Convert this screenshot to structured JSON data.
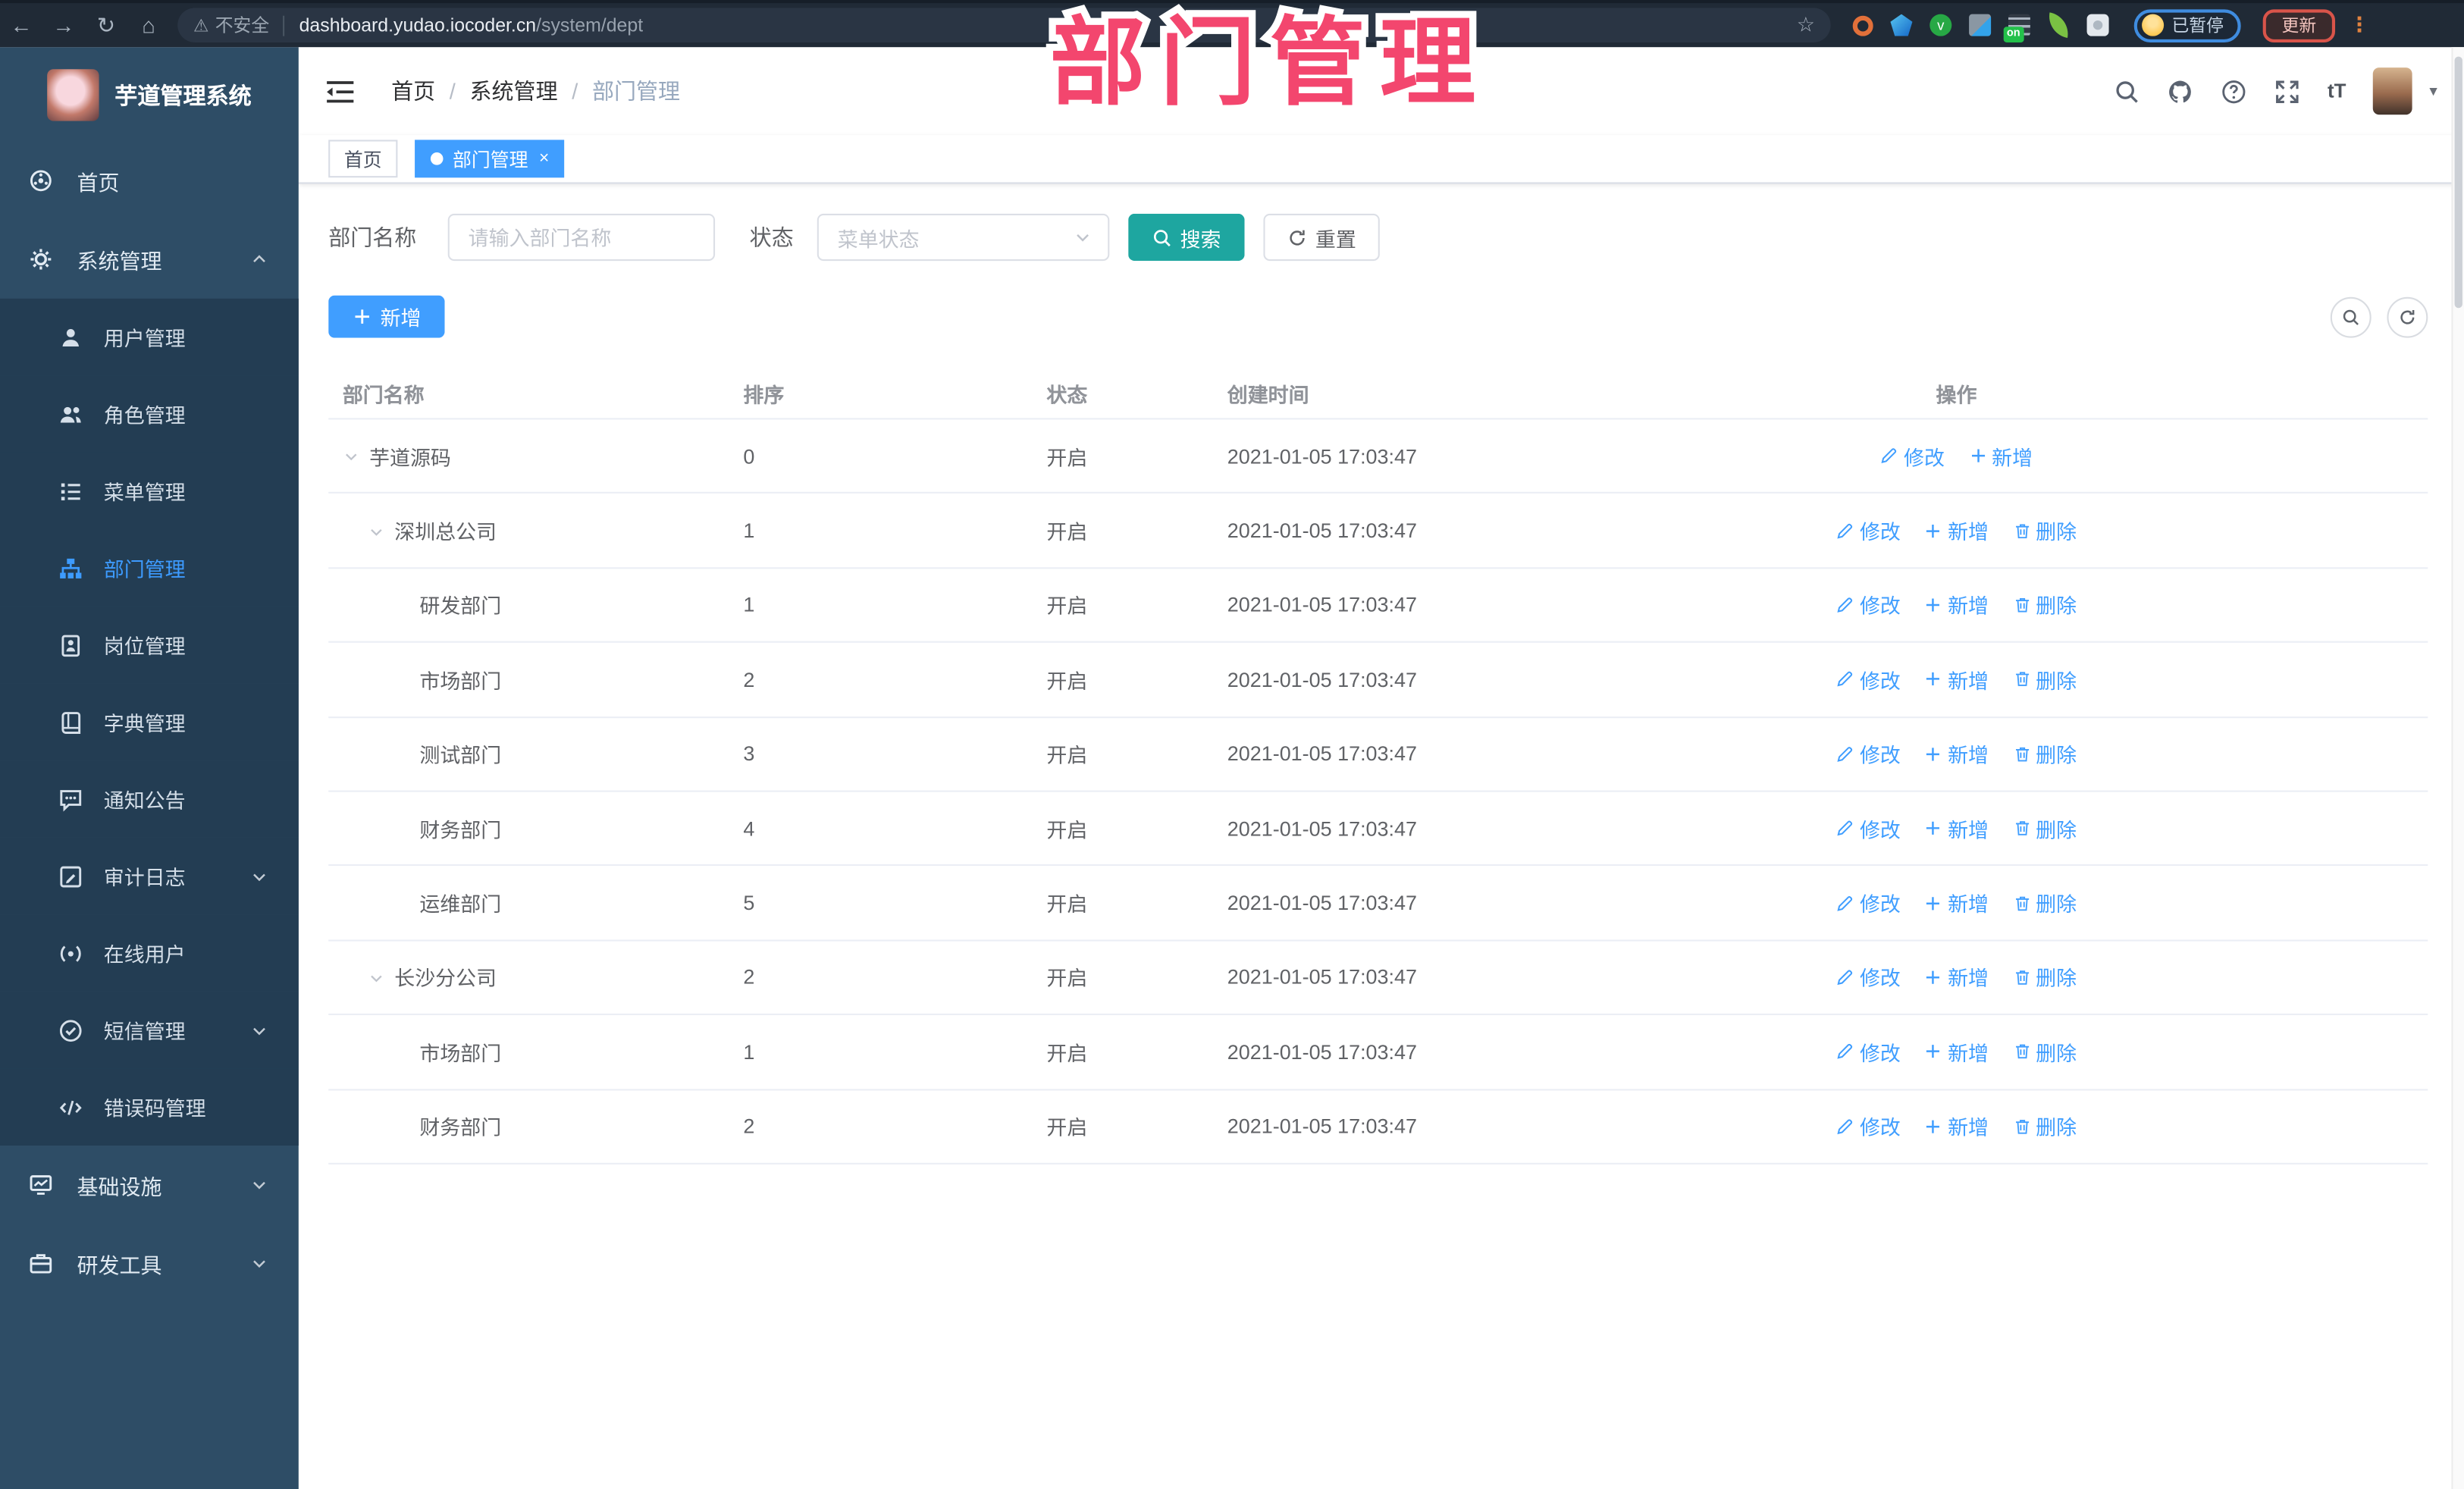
{
  "colors": {
    "accent": "#409eff",
    "search_button_teal": "#1ea6a0",
    "sidebar_bg": "#2e4d66",
    "submenu_bg": "#233d53",
    "overlay_pink": "#f3466e",
    "tab_active_blue": "#409eff"
  },
  "browser": {
    "security_label": "不安全",
    "url_host": "dashboard.yudao.iocoder.cn",
    "url_path": "/system/dept",
    "paused_label": "已暂停",
    "update_label": "更新",
    "extension_on_badge": "on",
    "extensions": [
      "orange-ring-extension-icon",
      "blue-gem-extension-icon",
      "green-check-extension-icon",
      "grey-grid-extension-icon",
      "dark-lines-extension-icon",
      "green-sprout-extension-icon",
      "white-puzzle-extension-icon"
    ]
  },
  "overlay": {
    "title": "部门管理"
  },
  "sidebar": {
    "app_title": "芋道管理系统",
    "items": [
      {
        "id": "home",
        "label": "首页",
        "icon": "dashboard-icon",
        "indent": "top"
      },
      {
        "id": "system",
        "label": "系统管理",
        "icon": "gear-icon",
        "indent": "top",
        "arrow": "up"
      },
      {
        "id": "user",
        "label": "用户管理",
        "icon": "user-icon",
        "indent": "sub"
      },
      {
        "id": "role",
        "label": "角色管理",
        "icon": "users-icon",
        "indent": "sub"
      },
      {
        "id": "menu",
        "label": "菜单管理",
        "icon": "menu-list-icon",
        "indent": "sub"
      },
      {
        "id": "dept",
        "label": "部门管理",
        "icon": "org-tree-icon",
        "indent": "sub",
        "active": true
      },
      {
        "id": "post",
        "label": "岗位管理",
        "icon": "badge-icon",
        "indent": "sub"
      },
      {
        "id": "dict",
        "label": "字典管理",
        "icon": "dictionary-icon",
        "indent": "sub"
      },
      {
        "id": "notice",
        "label": "通知公告",
        "icon": "announcement-icon",
        "indent": "sub"
      },
      {
        "id": "audit",
        "label": "审计日志",
        "icon": "audit-log-icon",
        "indent": "sub",
        "arrow": "down"
      },
      {
        "id": "online",
        "label": "在线用户",
        "icon": "online-user-icon",
        "indent": "sub"
      },
      {
        "id": "sms",
        "label": "短信管理",
        "icon": "sms-icon",
        "indent": "sub",
        "arrow": "down"
      },
      {
        "id": "errcode",
        "label": "错误码管理",
        "icon": "error-code-icon",
        "indent": "sub"
      },
      {
        "id": "infra",
        "label": "基础设施",
        "icon": "infrastructure-icon",
        "indent": "top",
        "arrow": "down"
      },
      {
        "id": "tools",
        "label": "研发工具",
        "icon": "briefcase-icon",
        "indent": "top",
        "arrow": "down"
      }
    ]
  },
  "header": {
    "breadcrumb": [
      "首页",
      "系统管理",
      "部门管理"
    ],
    "breadcrumb_separator": "/",
    "font_size_icon_label": "tT"
  },
  "tabs": [
    {
      "label": "首页",
      "active": false,
      "closable": false
    },
    {
      "label": "部门管理",
      "active": true,
      "closable": true
    }
  ],
  "filters": {
    "name_label": "部门名称",
    "name_placeholder": "请输入部门名称",
    "status_label": "状态",
    "status_placeholder": "菜单状态",
    "search_label": "搜索",
    "reset_label": "重置"
  },
  "toolbar": {
    "add_label": "新增"
  },
  "table": {
    "columns": [
      "部门名称",
      "排序",
      "状态",
      "创建时间",
      "操作"
    ],
    "action_labels": {
      "edit": "修改",
      "add": "新增",
      "delete": "删除"
    },
    "rows": [
      {
        "name": "芋道源码",
        "level": 0,
        "expandable": true,
        "sort": "0",
        "status": "开启",
        "created": "2021-01-05 17:03:47",
        "actions": [
          "edit",
          "add"
        ]
      },
      {
        "name": "深圳总公司",
        "level": 1,
        "expandable": true,
        "sort": "1",
        "status": "开启",
        "created": "2021-01-05 17:03:47",
        "actions": [
          "edit",
          "add",
          "delete"
        ]
      },
      {
        "name": "研发部门",
        "level": 2,
        "expandable": false,
        "sort": "1",
        "status": "开启",
        "created": "2021-01-05 17:03:47",
        "actions": [
          "edit",
          "add",
          "delete"
        ]
      },
      {
        "name": "市场部门",
        "level": 2,
        "expandable": false,
        "sort": "2",
        "status": "开启",
        "created": "2021-01-05 17:03:47",
        "actions": [
          "edit",
          "add",
          "delete"
        ]
      },
      {
        "name": "测试部门",
        "level": 2,
        "expandable": false,
        "sort": "3",
        "status": "开启",
        "created": "2021-01-05 17:03:47",
        "actions": [
          "edit",
          "add",
          "delete"
        ]
      },
      {
        "name": "财务部门",
        "level": 2,
        "expandable": false,
        "sort": "4",
        "status": "开启",
        "created": "2021-01-05 17:03:47",
        "actions": [
          "edit",
          "add",
          "delete"
        ]
      },
      {
        "name": "运维部门",
        "level": 2,
        "expandable": false,
        "sort": "5",
        "status": "开启",
        "created": "2021-01-05 17:03:47",
        "actions": [
          "edit",
          "add",
          "delete"
        ]
      },
      {
        "name": "长沙分公司",
        "level": 1,
        "expandable": true,
        "sort": "2",
        "status": "开启",
        "created": "2021-01-05 17:03:47",
        "actions": [
          "edit",
          "add",
          "delete"
        ]
      },
      {
        "name": "市场部门",
        "level": 2,
        "expandable": false,
        "sort": "1",
        "status": "开启",
        "created": "2021-01-05 17:03:47",
        "actions": [
          "edit",
          "add",
          "delete"
        ]
      },
      {
        "name": "财务部门",
        "level": 2,
        "expandable": false,
        "sort": "2",
        "status": "开启",
        "created": "2021-01-05 17:03:47",
        "actions": [
          "edit",
          "add",
          "delete"
        ]
      }
    ]
  }
}
